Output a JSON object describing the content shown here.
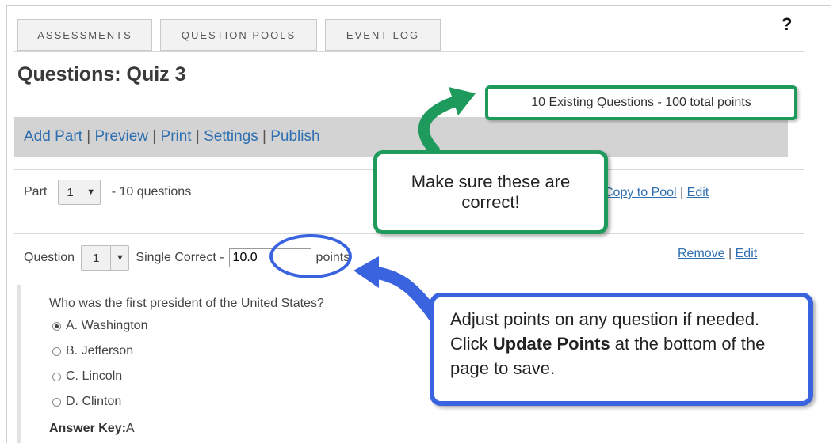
{
  "tabs": [
    "ASSESSMENTS",
    "QUESTION POOLS",
    "EVENT LOG"
  ],
  "help_label": "?",
  "page_title": "Questions: Quiz 3",
  "existing_summary": "10 Existing Questions - 100 total points",
  "actions": {
    "add_part": "Add Part",
    "preview": "Preview",
    "print": "Print",
    "settings": "Settings",
    "publish": "Publish",
    "separator": " | "
  },
  "part": {
    "label": "Part",
    "selected": "1",
    "count_text": "- 10 questions",
    "copy_to_pool": "Copy to Pool",
    "edit": "Edit"
  },
  "question": {
    "label": "Question",
    "selected": "1",
    "type": "Single Correct -",
    "points_value": "10.0",
    "points_label": "points",
    "remove": "Remove",
    "edit": "Edit",
    "text": "Who was the first president of the United States?",
    "options": [
      {
        "label": "A. Washington",
        "selected": true
      },
      {
        "label": "B. Jefferson",
        "selected": false
      },
      {
        "label": "C. Lincoln",
        "selected": false
      },
      {
        "label": "D. Clinton",
        "selected": false
      }
    ],
    "answer_key_label": "Answer Key:",
    "answer_key_value": "A"
  },
  "callouts": {
    "verify": "Make sure these are correct!",
    "adjust_pre": "Adjust points on any question if needed. Click ",
    "adjust_bold": "Update Points",
    "adjust_post": " at the bottom of the page to save."
  },
  "colors": {
    "green_callout": "#1e9a5c",
    "blue_callout": "#3a63e0",
    "link": "#2f6fb0"
  }
}
